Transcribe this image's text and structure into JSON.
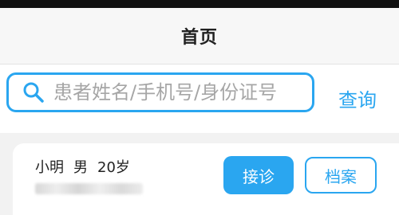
{
  "header": {
    "title": "首页"
  },
  "search": {
    "placeholder": "患者姓名/手机号/身份证号",
    "value": "",
    "icon": "search-icon",
    "query_label": "查询"
  },
  "patients": [
    {
      "name": "小明",
      "gender": "男",
      "age": "20岁",
      "admit_label": "接诊",
      "record_label": "档案"
    }
  ],
  "colors": {
    "accent": "#2aa6f0",
    "background": "#f2f2f2",
    "status_bar": "#111111"
  }
}
